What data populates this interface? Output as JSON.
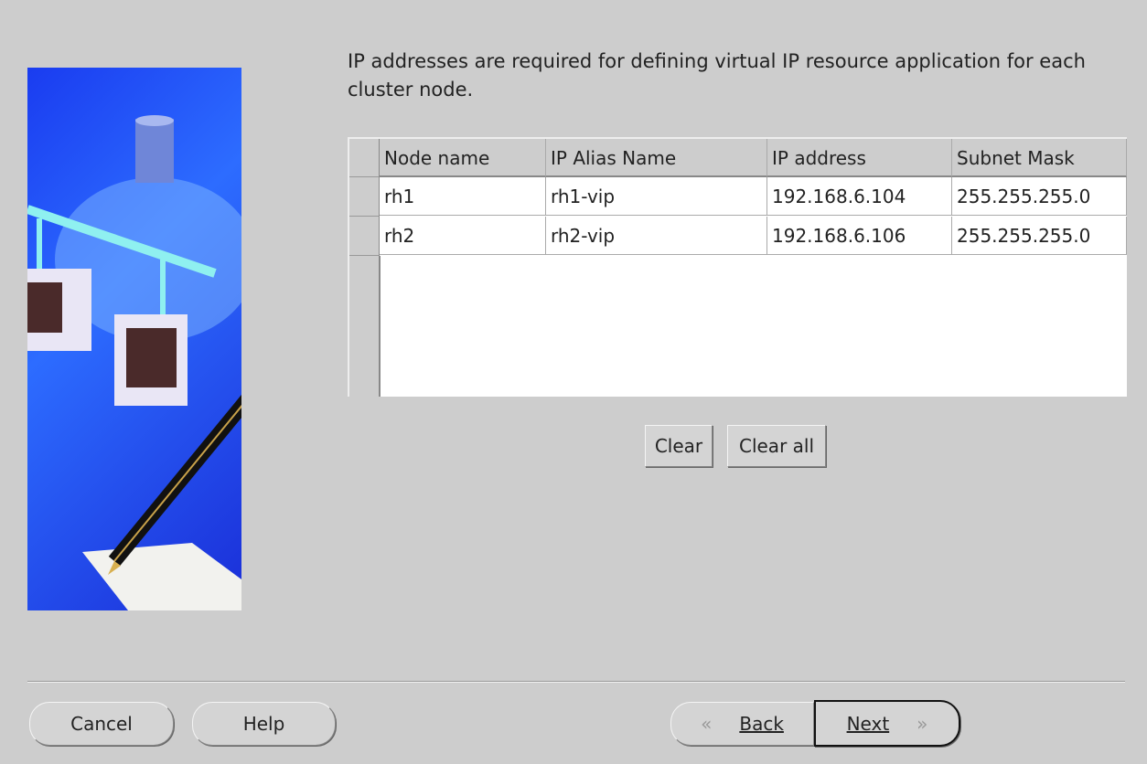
{
  "description": "IP addresses are required for defining virtual IP resource application for each cluster node.",
  "table": {
    "columns": [
      "Node name",
      "IP Alias Name",
      "IP address",
      "Subnet Mask"
    ],
    "rows": [
      [
        "rh1",
        "rh1-vip",
        "192.168.6.104",
        "255.255.255.0"
      ],
      [
        "rh2",
        "rh2-vip",
        "192.168.6.106",
        "255.255.255.0"
      ]
    ]
  },
  "buttons": {
    "clear": "Clear",
    "clear_all": "Clear all",
    "cancel": "Cancel",
    "help": "Help",
    "back": "Back",
    "next": "Next"
  }
}
